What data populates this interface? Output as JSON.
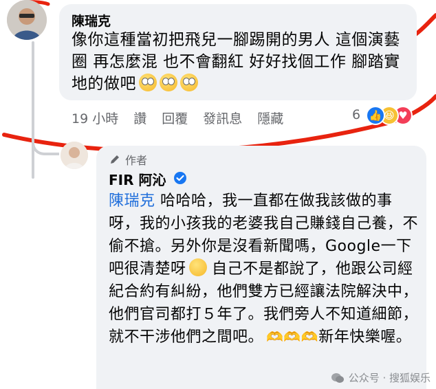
{
  "comment1": {
    "author": "陳瑞克",
    "text": "像你這種當初把飛兒一腳踢開的男人 這個演藝圈 再怎麼混 也不會翻紅 好好找個工作 腳踏實地的做吧",
    "emoji": "face-with-rolling-eyes-emoji",
    "actions": {
      "time": "19 小時",
      "like": "讚",
      "reply": "回覆",
      "message": "發訊息",
      "hide": "隱藏"
    },
    "reaction_count": "6",
    "reactions": [
      "like-icon",
      "haha-icon",
      "love-icon"
    ]
  },
  "comment2": {
    "author_tag": "作者",
    "author": "FIR 阿沁",
    "mention": "陳瑞克",
    "text_part1": " 哈哈哈，我一直都在做我該做的事呀，我的小孩我的老婆我自己賺錢自己養，不偷不搶。另外你是沒看新聞嗎，Google一下吧很清楚呀",
    "text_part2": " 自己不是都說了，他跟公司經紀合約有糾紛，他們雙方已經讓法院解決中，他們官司都打５年了。我們旁人不知道細節，就不干涉他們之間吧。",
    "hands_emoji": "🫶🫶🫶",
    "text_part3": "新年快樂喔。"
  },
  "watermark": {
    "text": "公众号 · 搜狐娱乐"
  },
  "colors": {
    "bubble": "#f0f2f5",
    "mention": "#216fdb",
    "meta": "#65676b",
    "annotation": "#e8230f",
    "like": "#1877f2"
  }
}
